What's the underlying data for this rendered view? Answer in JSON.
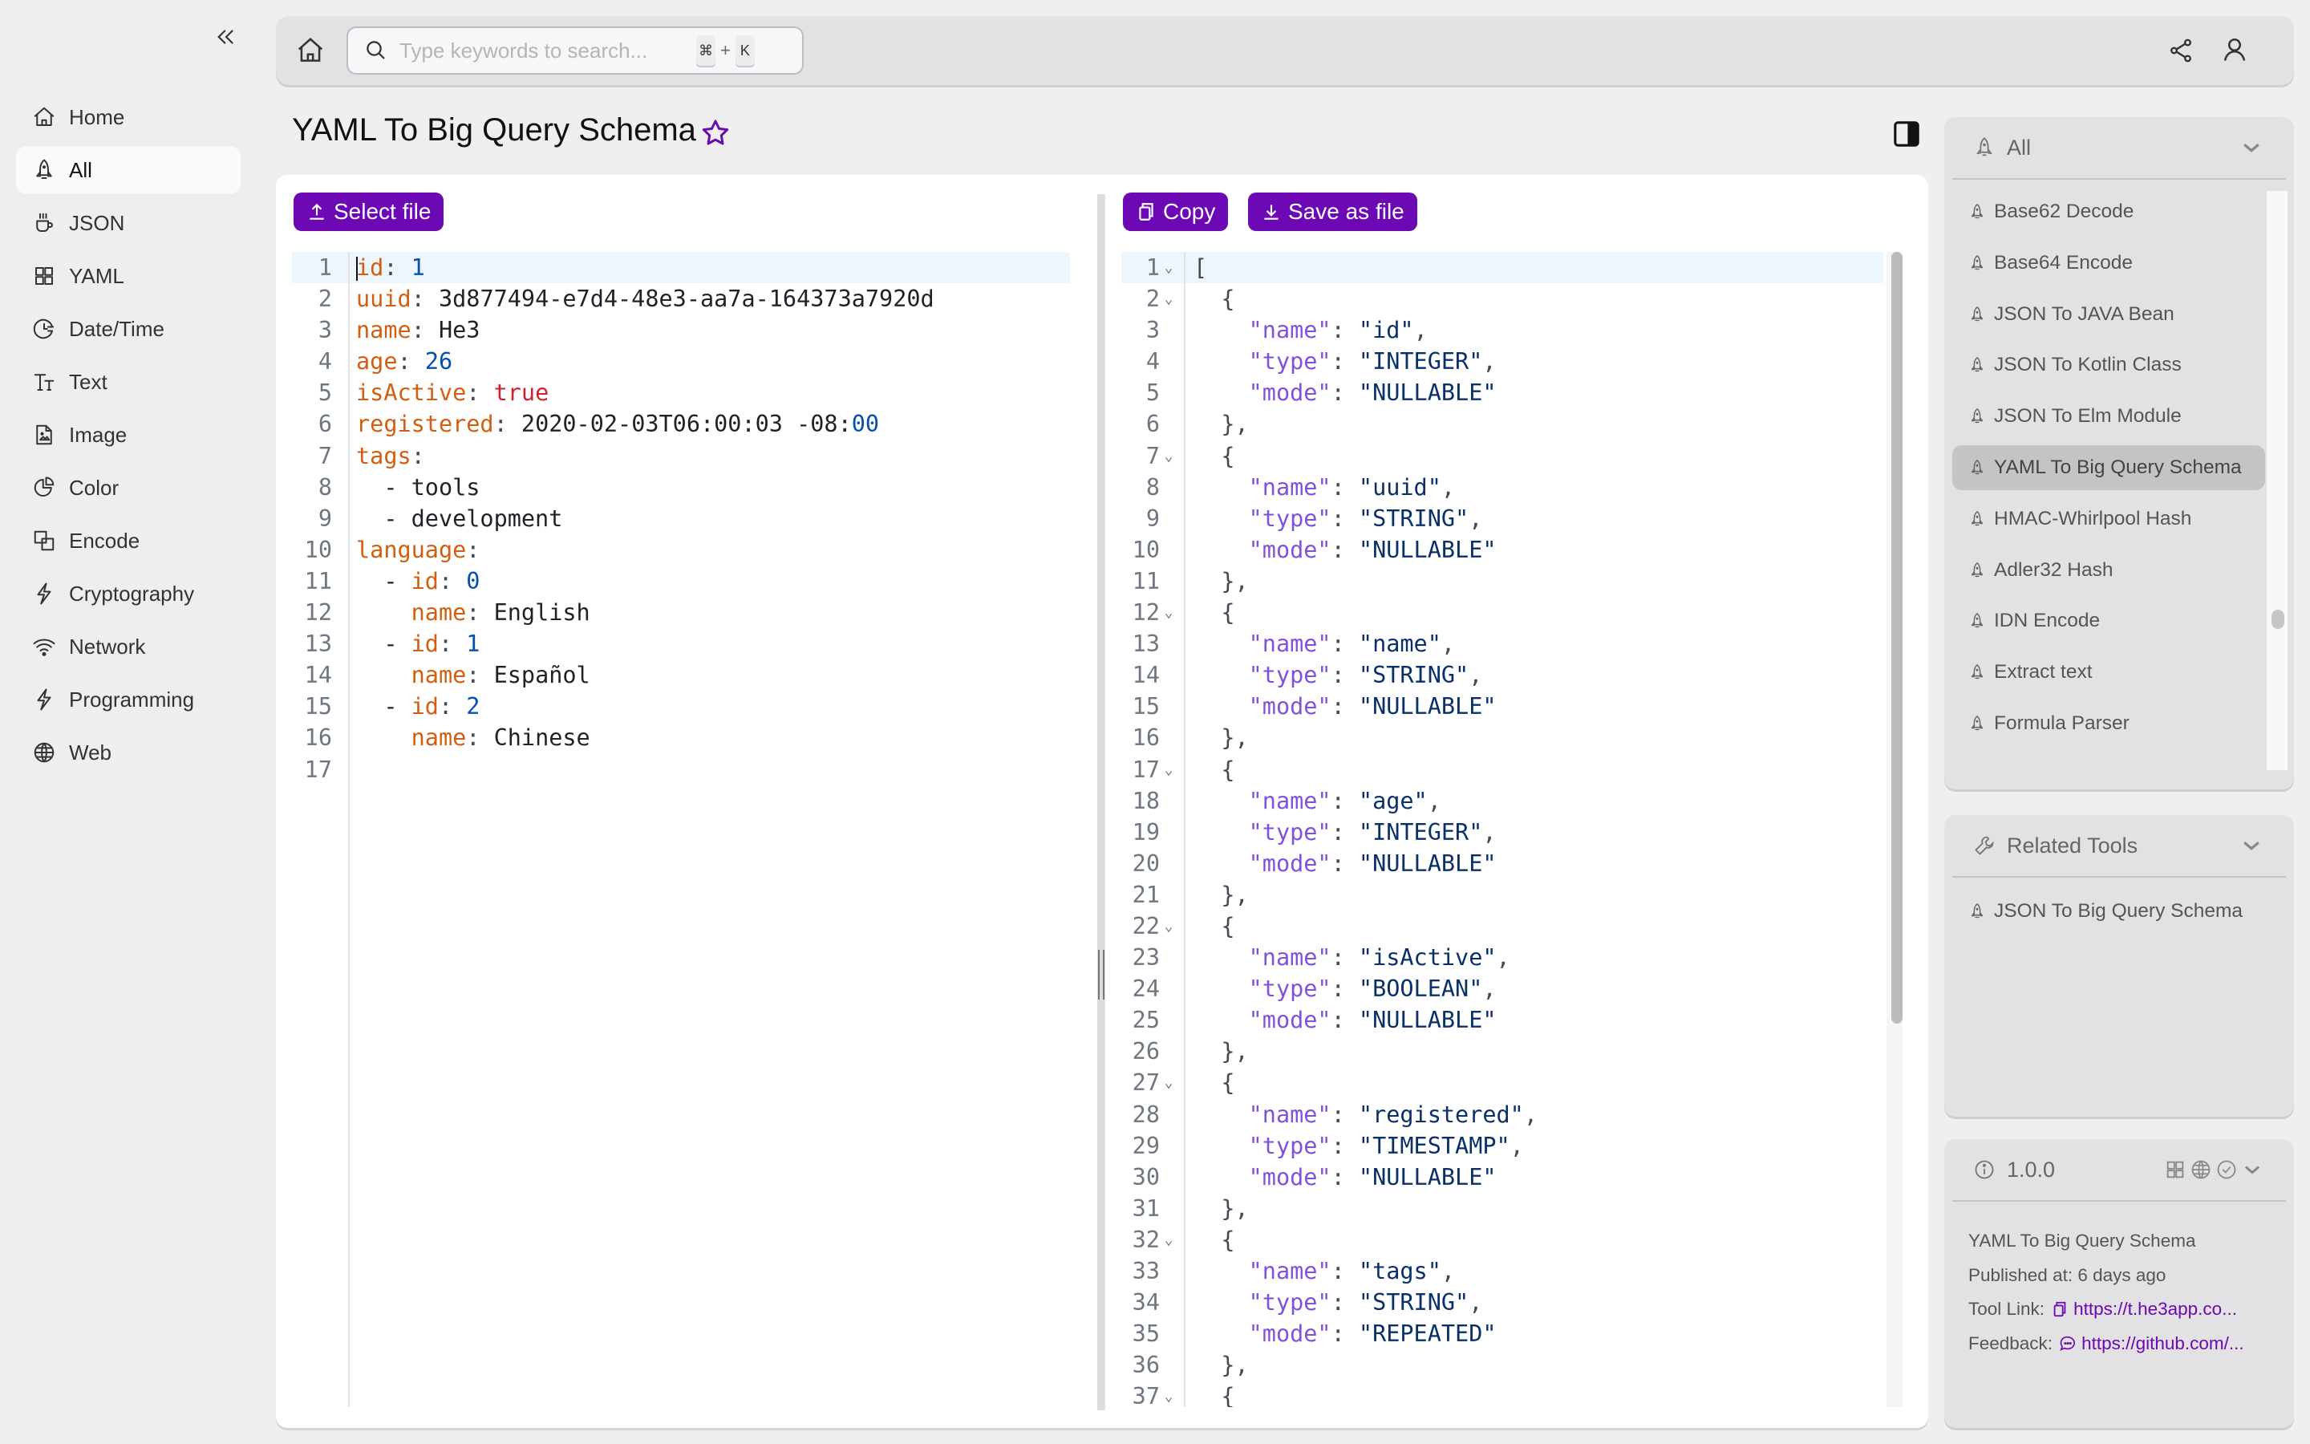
{
  "sidebar": {
    "collapse_icon": "double-chevron-left-icon",
    "items": [
      {
        "label": "Home",
        "icon": "home-icon"
      },
      {
        "label": "All",
        "icon": "rocket-icon",
        "active": true
      },
      {
        "label": "JSON",
        "icon": "cup-icon"
      },
      {
        "label": "YAML",
        "icon": "grid-icon"
      },
      {
        "label": "Date/Time",
        "icon": "clock-icon"
      },
      {
        "label": "Text",
        "icon": "text-icon"
      },
      {
        "label": "Image",
        "icon": "image-file-icon"
      },
      {
        "label": "Color",
        "icon": "pie-icon"
      },
      {
        "label": "Encode",
        "icon": "squares-icon"
      },
      {
        "label": "Cryptography",
        "icon": "bolt-icon"
      },
      {
        "label": "Network",
        "icon": "wifi-icon"
      },
      {
        "label": "Programming",
        "icon": "bolt-icon"
      },
      {
        "label": "Web",
        "icon": "globe-icon"
      }
    ]
  },
  "topbar": {
    "search_placeholder": "Type keywords to search...",
    "shortcut_key1": "⌘",
    "shortcut_plus": "+",
    "shortcut_key2": "K"
  },
  "page": {
    "title": "YAML To Big Query Schema",
    "favorite": false
  },
  "toolbar": {
    "select_file_label": "Select file",
    "copy_label": "Copy",
    "save_label": "Save as file"
  },
  "input_editor": {
    "language": "yaml",
    "active_line": 1,
    "lines": [
      [
        [
          "k",
          "id"
        ],
        [
          "p",
          ": "
        ],
        [
          "n",
          "1"
        ]
      ],
      [
        [
          "k",
          "uuid"
        ],
        [
          "p",
          ": "
        ],
        [
          "t",
          "3d877494-e7d4-48e3-aa7a-164373a7920d"
        ]
      ],
      [
        [
          "k",
          "name"
        ],
        [
          "p",
          ": "
        ],
        [
          "t",
          "He3"
        ]
      ],
      [
        [
          "k",
          "age"
        ],
        [
          "p",
          ": "
        ],
        [
          "n",
          "26"
        ]
      ],
      [
        [
          "k",
          "isActive"
        ],
        [
          "p",
          ": "
        ],
        [
          "b",
          "true"
        ]
      ],
      [
        [
          "k",
          "registered"
        ],
        [
          "p",
          ": "
        ],
        [
          "t",
          "2020-02-03T06:00:03 -08:"
        ],
        [
          "n",
          "00"
        ]
      ],
      [
        [
          "k",
          "tags"
        ],
        [
          "p",
          ":"
        ]
      ],
      [
        [
          "t",
          "  - tools"
        ]
      ],
      [
        [
          "t",
          "  - development"
        ]
      ],
      [
        [
          "k",
          "language"
        ],
        [
          "p",
          ":"
        ]
      ],
      [
        [
          "t",
          "  - "
        ],
        [
          "k",
          "id"
        ],
        [
          "p",
          ": "
        ],
        [
          "n",
          "0"
        ]
      ],
      [
        [
          "t",
          "    "
        ],
        [
          "k",
          "name"
        ],
        [
          "p",
          ": "
        ],
        [
          "t",
          "English"
        ]
      ],
      [
        [
          "t",
          "  - "
        ],
        [
          "k",
          "id"
        ],
        [
          "p",
          ": "
        ],
        [
          "n",
          "1"
        ]
      ],
      [
        [
          "t",
          "    "
        ],
        [
          "k",
          "name"
        ],
        [
          "p",
          ": "
        ],
        [
          "t",
          "Español"
        ]
      ],
      [
        [
          "t",
          "  - "
        ],
        [
          "k",
          "id"
        ],
        [
          "p",
          ": "
        ],
        [
          "n",
          "2"
        ]
      ],
      [
        [
          "t",
          "    "
        ],
        [
          "k",
          "name"
        ],
        [
          "p",
          ": "
        ],
        [
          "t",
          "Chinese"
        ]
      ],
      []
    ]
  },
  "output_editor": {
    "language": "json",
    "active_line": 1,
    "fold_lines": [
      1,
      2,
      7,
      12,
      17,
      22,
      27,
      32,
      37
    ],
    "lines": [
      [
        [
          "p",
          "["
        ]
      ],
      [
        [
          "p",
          "  {"
        ]
      ],
      [
        [
          "t",
          "    "
        ],
        [
          "jk",
          "\"name\""
        ],
        [
          "p",
          ": "
        ],
        [
          "js",
          "\"id\""
        ],
        [
          "p",
          ","
        ]
      ],
      [
        [
          "t",
          "    "
        ],
        [
          "jk",
          "\"type\""
        ],
        [
          "p",
          ": "
        ],
        [
          "js",
          "\"INTEGER\""
        ],
        [
          "p",
          ","
        ]
      ],
      [
        [
          "t",
          "    "
        ],
        [
          "jk",
          "\"mode\""
        ],
        [
          "p",
          ": "
        ],
        [
          "js",
          "\"NULLABLE\""
        ]
      ],
      [
        [
          "p",
          "  },"
        ]
      ],
      [
        [
          "p",
          "  {"
        ]
      ],
      [
        [
          "t",
          "    "
        ],
        [
          "jk",
          "\"name\""
        ],
        [
          "p",
          ": "
        ],
        [
          "js",
          "\"uuid\""
        ],
        [
          "p",
          ","
        ]
      ],
      [
        [
          "t",
          "    "
        ],
        [
          "jk",
          "\"type\""
        ],
        [
          "p",
          ": "
        ],
        [
          "js",
          "\"STRING\""
        ],
        [
          "p",
          ","
        ]
      ],
      [
        [
          "t",
          "    "
        ],
        [
          "jk",
          "\"mode\""
        ],
        [
          "p",
          ": "
        ],
        [
          "js",
          "\"NULLABLE\""
        ]
      ],
      [
        [
          "p",
          "  },"
        ]
      ],
      [
        [
          "p",
          "  {"
        ]
      ],
      [
        [
          "t",
          "    "
        ],
        [
          "jk",
          "\"name\""
        ],
        [
          "p",
          ": "
        ],
        [
          "js",
          "\"name\""
        ],
        [
          "p",
          ","
        ]
      ],
      [
        [
          "t",
          "    "
        ],
        [
          "jk",
          "\"type\""
        ],
        [
          "p",
          ": "
        ],
        [
          "js",
          "\"STRING\""
        ],
        [
          "p",
          ","
        ]
      ],
      [
        [
          "t",
          "    "
        ],
        [
          "jk",
          "\"mode\""
        ],
        [
          "p",
          ": "
        ],
        [
          "js",
          "\"NULLABLE\""
        ]
      ],
      [
        [
          "p",
          "  },"
        ]
      ],
      [
        [
          "p",
          "  {"
        ]
      ],
      [
        [
          "t",
          "    "
        ],
        [
          "jk",
          "\"name\""
        ],
        [
          "p",
          ": "
        ],
        [
          "js",
          "\"age\""
        ],
        [
          "p",
          ","
        ]
      ],
      [
        [
          "t",
          "    "
        ],
        [
          "jk",
          "\"type\""
        ],
        [
          "p",
          ": "
        ],
        [
          "js",
          "\"INTEGER\""
        ],
        [
          "p",
          ","
        ]
      ],
      [
        [
          "t",
          "    "
        ],
        [
          "jk",
          "\"mode\""
        ],
        [
          "p",
          ": "
        ],
        [
          "js",
          "\"NULLABLE\""
        ]
      ],
      [
        [
          "p",
          "  },"
        ]
      ],
      [
        [
          "p",
          "  {"
        ]
      ],
      [
        [
          "t",
          "    "
        ],
        [
          "jk",
          "\"name\""
        ],
        [
          "p",
          ": "
        ],
        [
          "js",
          "\"isActive\""
        ],
        [
          "p",
          ","
        ]
      ],
      [
        [
          "t",
          "    "
        ],
        [
          "jk",
          "\"type\""
        ],
        [
          "p",
          ": "
        ],
        [
          "js",
          "\"BOOLEAN\""
        ],
        [
          "p",
          ","
        ]
      ],
      [
        [
          "t",
          "    "
        ],
        [
          "jk",
          "\"mode\""
        ],
        [
          "p",
          ": "
        ],
        [
          "js",
          "\"NULLABLE\""
        ]
      ],
      [
        [
          "p",
          "  },"
        ]
      ],
      [
        [
          "p",
          "  {"
        ]
      ],
      [
        [
          "t",
          "    "
        ],
        [
          "jk",
          "\"name\""
        ],
        [
          "p",
          ": "
        ],
        [
          "js",
          "\"registered\""
        ],
        [
          "p",
          ","
        ]
      ],
      [
        [
          "t",
          "    "
        ],
        [
          "jk",
          "\"type\""
        ],
        [
          "p",
          ": "
        ],
        [
          "js",
          "\"TIMESTAMP\""
        ],
        [
          "p",
          ","
        ]
      ],
      [
        [
          "t",
          "    "
        ],
        [
          "jk",
          "\"mode\""
        ],
        [
          "p",
          ": "
        ],
        [
          "js",
          "\"NULLABLE\""
        ]
      ],
      [
        [
          "p",
          "  },"
        ]
      ],
      [
        [
          "p",
          "  {"
        ]
      ],
      [
        [
          "t",
          "    "
        ],
        [
          "jk",
          "\"name\""
        ],
        [
          "p",
          ": "
        ],
        [
          "js",
          "\"tags\""
        ],
        [
          "p",
          ","
        ]
      ],
      [
        [
          "t",
          "    "
        ],
        [
          "jk",
          "\"type\""
        ],
        [
          "p",
          ": "
        ],
        [
          "js",
          "\"STRING\""
        ],
        [
          "p",
          ","
        ]
      ],
      [
        [
          "t",
          "    "
        ],
        [
          "jk",
          "\"mode\""
        ],
        [
          "p",
          ": "
        ],
        [
          "js",
          "\"REPEATED\""
        ]
      ],
      [
        [
          "p",
          "  },"
        ]
      ],
      [
        [
          "p",
          "  {"
        ]
      ]
    ]
  },
  "category_panel": {
    "title": "All",
    "tools": [
      {
        "label": "Base62 Decode"
      },
      {
        "label": "Base64 Encode"
      },
      {
        "label": "JSON To JAVA Bean"
      },
      {
        "label": "JSON To Kotlin Class"
      },
      {
        "label": "JSON To Elm Module"
      },
      {
        "label": "YAML To Big Query Schema",
        "active": true
      },
      {
        "label": "HMAC-Whirlpool Hash"
      },
      {
        "label": "Adler32 Hash"
      },
      {
        "label": "IDN Encode"
      },
      {
        "label": "Extract text"
      },
      {
        "label": "Formula Parser"
      }
    ]
  },
  "related_panel": {
    "title": "Related Tools",
    "tools": [
      {
        "label": "JSON To Big Query Schema"
      }
    ]
  },
  "info_panel": {
    "version": "1.0.0",
    "tool_name": "YAML To Big Query Schema",
    "published_label": "Published at:",
    "published_value": "6 days ago",
    "tool_link_label": "Tool Link:",
    "tool_link_value": "https://t.he3app.co...",
    "feedback_label": "Feedback:",
    "feedback_value": "https://github.com/..."
  },
  "colors": {
    "accent": "#6c08b4",
    "yaml_key": "#d35e0f",
    "number": "#0550ae",
    "boolean": "#cf222e",
    "json_key": "#8250df",
    "json_string": "#0a3069"
  }
}
